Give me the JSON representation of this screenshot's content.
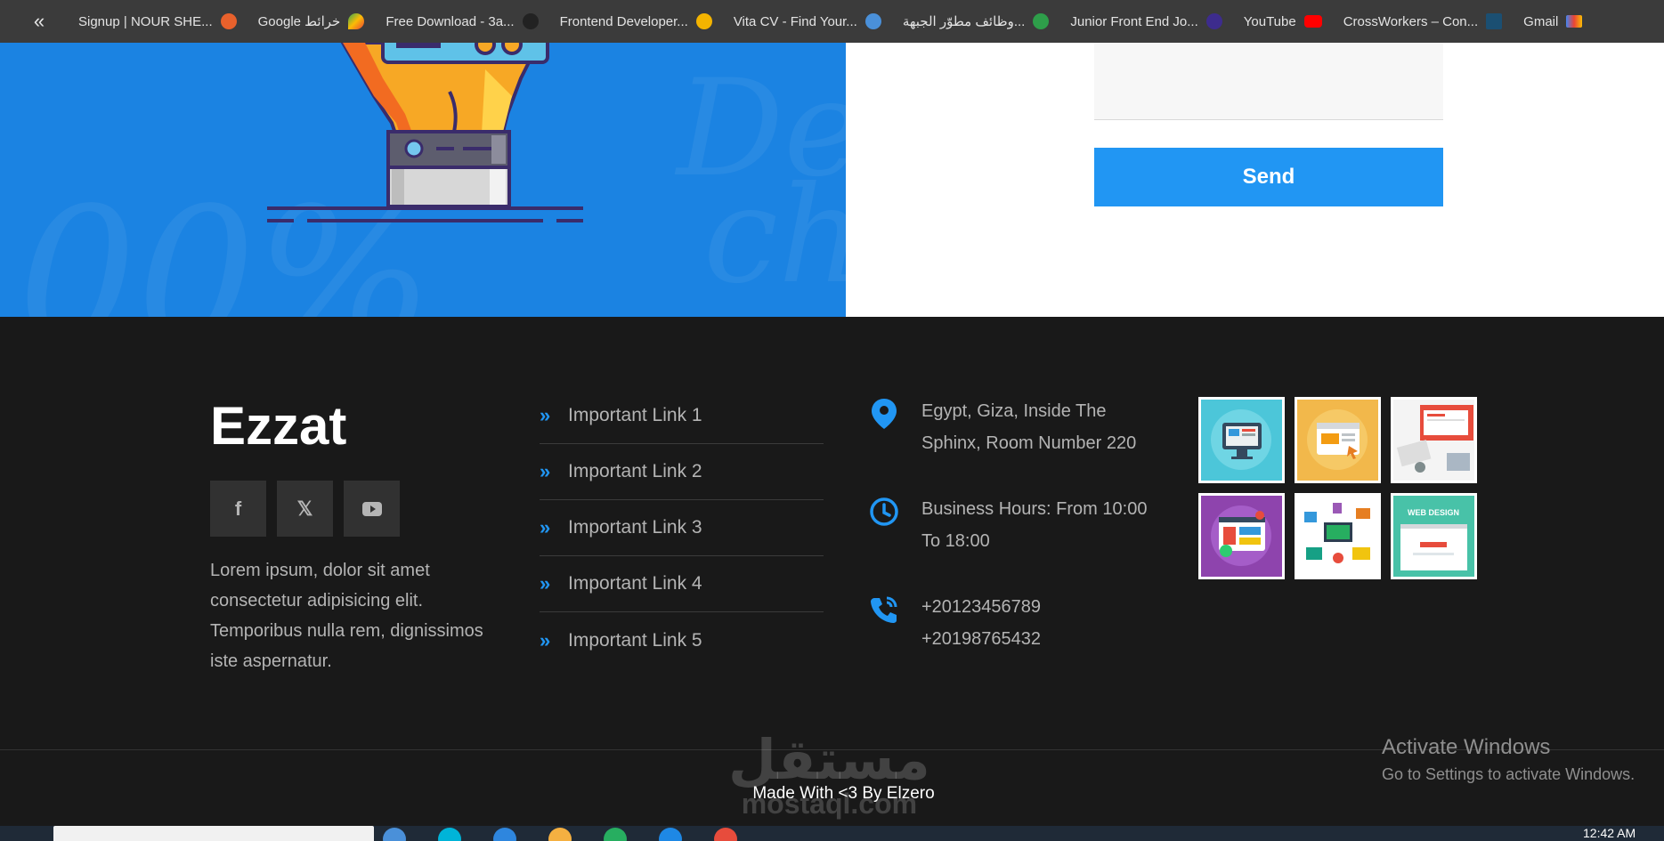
{
  "bookmarks": {
    "toggle_glyph": "«",
    "items": [
      {
        "label": "Signup | NOUR SHE...",
        "color": "#e8612c"
      },
      {
        "label": "Google خرائط",
        "color": "#34a853"
      },
      {
        "label": "Free Download - 3a...",
        "color": "#222222"
      },
      {
        "label": "Frontend Developer...",
        "color": "#f4b400"
      },
      {
        "label": "Vita CV - Find Your...",
        "color": "#4a90d9"
      },
      {
        "label": "وظائف مطوّر الجبهة...",
        "color": "#2e9e4a"
      },
      {
        "label": "Junior Front End Jo...",
        "color": "#3d2c8d"
      },
      {
        "label": "YouTube",
        "color": "#ff0000"
      },
      {
        "label": "CrossWorkers – Con...",
        "color": "#1b6cb0"
      },
      {
        "label": "Gmail",
        "color": "#ea4335"
      }
    ]
  },
  "contact_form": {
    "send_label": "Send"
  },
  "footer": {
    "brand": "Ezzat",
    "social": {
      "facebook_glyph": "f",
      "x_glyph": "𝕏"
    },
    "about_text": "Lorem ipsum, dolor sit amet consectetur adipisicing elit. Temporibus nulla rem, dignissimos iste aspernatur.",
    "links": [
      {
        "label": "Important Link 1"
      },
      {
        "label": "Important Link 2"
      },
      {
        "label": "Important Link 3"
      },
      {
        "label": "Important Link 4"
      },
      {
        "label": "Important Link 5"
      }
    ],
    "contact": {
      "address_line1": "Egypt, Giza, Inside The",
      "address_line2": "Sphinx, Room Number 220",
      "hours_line1": "Business Hours: From 10:00",
      "hours_line2": "To 18:00",
      "phone1": "+20123456789",
      "phone2": "+20198765432"
    },
    "gallery_captions": {
      "web_design": "WEB DESIGN"
    },
    "made_with": "Made With <3 By Elzero"
  },
  "watermark": {
    "arabic": "مستقل",
    "latin": "mostaql.com"
  },
  "activation": {
    "title": "Activate Windows",
    "subtitle": "Go to Settings to activate Windows."
  },
  "taskbar": {
    "clock": "12:42 AM"
  },
  "colors": {
    "accent": "#2196f3",
    "hero_bg": "#1b83e2",
    "footer_bg": "#191919"
  }
}
